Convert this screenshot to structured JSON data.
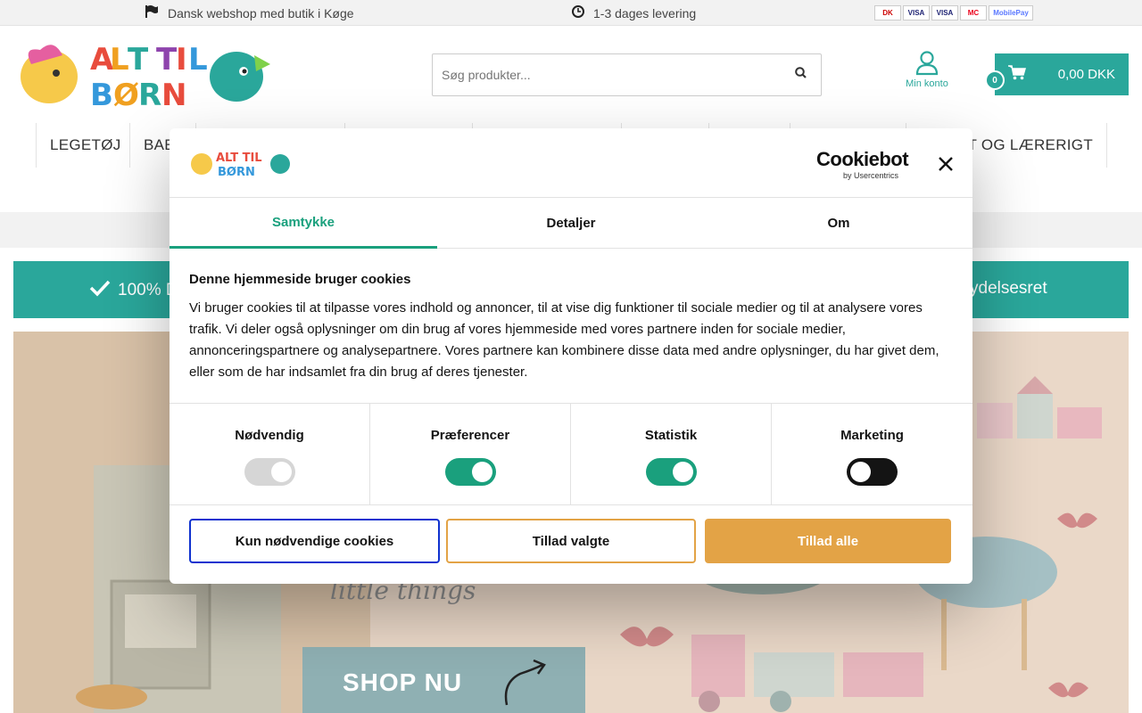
{
  "topbar": {
    "shop_text": "Dansk webshop med butik i Køge",
    "delivery_text": "1-3 dages levering",
    "payment_icons": [
      "DK",
      "VISA",
      "VISA",
      "MC",
      "MobilePay"
    ]
  },
  "header": {
    "logo_text": "ALT TIL BØRN",
    "search_placeholder": "Søg produkter...",
    "account_label": "Min konto",
    "cart_count": "0",
    "cart_total": "0,00 DKK"
  },
  "nav": {
    "items": [
      "LEGETØJ",
      "BAE",
      "VT OG LÆRERIGT"
    ]
  },
  "banner": {
    "left_text": "100% D",
    "right_text": "ydelsesret"
  },
  "hero": {
    "shop_label": "SHOP NU",
    "script_text": "little things"
  },
  "cookie_dialog": {
    "logo_text": "ALT TIL BØRN",
    "brand_title": "Cookiebot",
    "brand_sub": "by Usercentrics",
    "tabs": [
      "Samtykke",
      "Detaljer",
      "Om"
    ],
    "active_tab": "Samtykke",
    "title": "Denne hjemmeside bruger cookies",
    "text": "Vi bruger cookies til at tilpasse vores indhold og annoncer, til at vise dig funktioner til sociale medier og til at analysere vores trafik. Vi deler også oplysninger om din brug af vores hjemmeside med vores partnere inden for sociale medier, annonceringspartnere og analysepartnere. Vores partnere kan kombinere disse data med andre oplysninger, du har givet dem, eller som de har indsamlet fra din brug af deres tjenester.",
    "categories": [
      {
        "label": "Nødvendig",
        "state": "disabled"
      },
      {
        "label": "Præferencer",
        "state": "on"
      },
      {
        "label": "Statistik",
        "state": "on"
      },
      {
        "label": "Marketing",
        "state": "off"
      }
    ],
    "buttons": {
      "necessary": "Kun nødvendige cookies",
      "selected": "Tillad valgte",
      "all": "Tillad alle"
    }
  },
  "colors": {
    "brand_teal": "#2aa79b",
    "cookie_green": "#1aa07d",
    "allow_orange": "#e3a346",
    "outline_blue": "#1032cf"
  }
}
